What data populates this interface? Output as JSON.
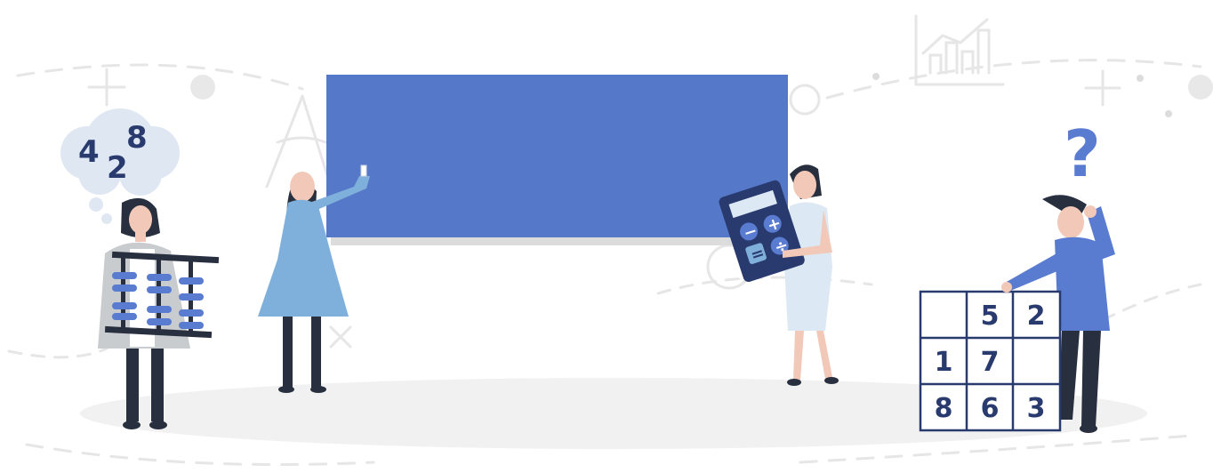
{
  "colors": {
    "board": "#5678c8",
    "navy": "#283a6e",
    "blue": "#5a7cd0",
    "light_blue": "#7fb0dc",
    "pale_blue": "#dde8f5",
    "cloud": "#dfe7f2",
    "dark": "#28303f",
    "skin": "#f2c9b8",
    "ground": "#f1f1f1",
    "deco": "#e4e4e4"
  },
  "thought": {
    "d1": "4",
    "d2": "2",
    "d3": "8"
  },
  "question_mark": "?",
  "calculator": {
    "minus": "−",
    "plus": "+",
    "equals": "=",
    "divide": "÷"
  },
  "grid": {
    "rows": [
      [
        "",
        "5",
        "2"
      ],
      [
        "1",
        "7",
        ""
      ],
      [
        "8",
        "6",
        "3"
      ]
    ]
  }
}
